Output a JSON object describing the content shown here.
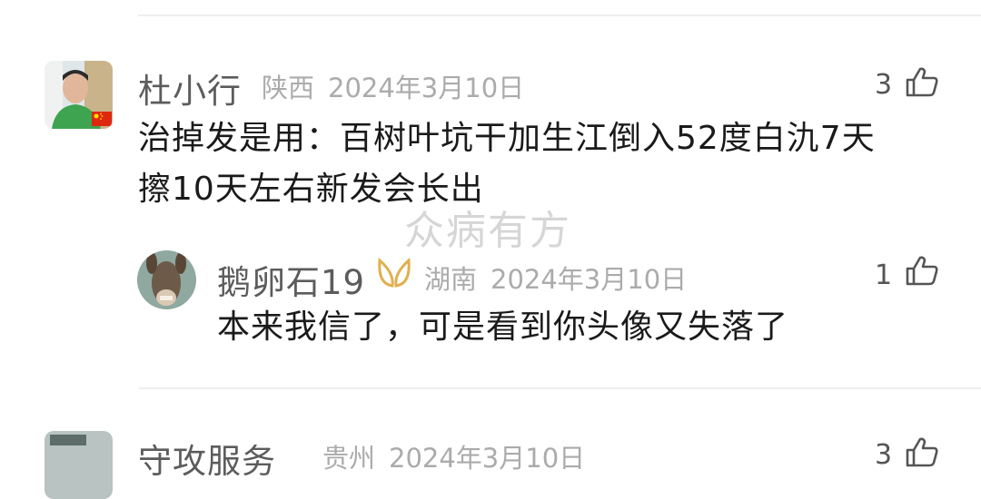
{
  "watermark": "众病有方",
  "comments": [
    {
      "username": "杜小行",
      "region": "陕西",
      "date": "2024年3月10日",
      "likes": "3",
      "content_line1": "治掉发是用：百树叶坑干加生江倒入52度白氿7天",
      "content_line2": "擦10天左右新发会长出"
    },
    {
      "username": "鹅卵石19",
      "region": "湖南",
      "date": "2024年3月10日",
      "likes": "1",
      "content": "本来我信了，可是看到你头像又失落了"
    },
    {
      "username": "守攻服务",
      "region": "贵州",
      "date": "2024年3月10日",
      "likes": "3"
    }
  ],
  "icons": {
    "like": "thumbs-up-icon",
    "badge": "vip-badge-icon",
    "flag": "china-flag-icon"
  },
  "colors": {
    "username": "#5c5c5c",
    "meta": "#ababab",
    "content": "#1a1a1a",
    "badge": "#e0b050"
  }
}
